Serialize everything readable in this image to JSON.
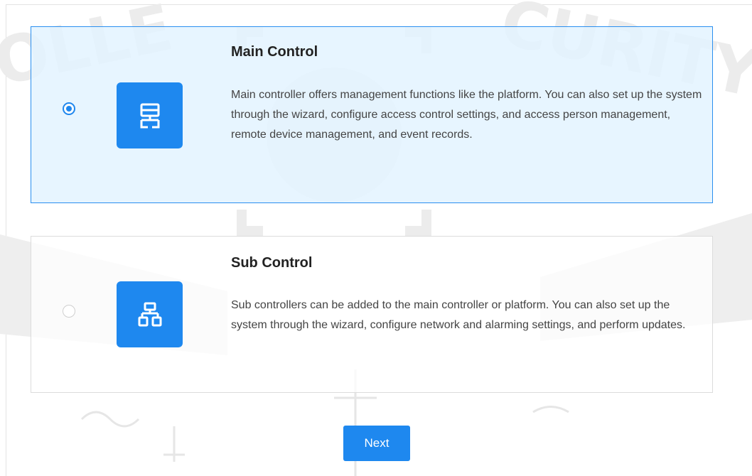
{
  "options": [
    {
      "title": "Main Control",
      "description": "Main controller offers management functions like the platform. You can also set up the system through the wizard, configure access control settings, and access person management, remote device management, and event records.",
      "selected": true,
      "icon": "network-hierarchy-icon"
    },
    {
      "title": "Sub Control",
      "description": "Sub controllers can be added to the main controller or platform. You can also set up the system through the wizard, configure network and alarming settings, and perform updates.",
      "selected": false,
      "icon": "network-tree-icon"
    }
  ],
  "actions": {
    "next_label": "Next"
  },
  "colors": {
    "accent": "#1e88ef",
    "selected_bg": "#e3f3ff",
    "selected_border": "#2a8ff0"
  }
}
